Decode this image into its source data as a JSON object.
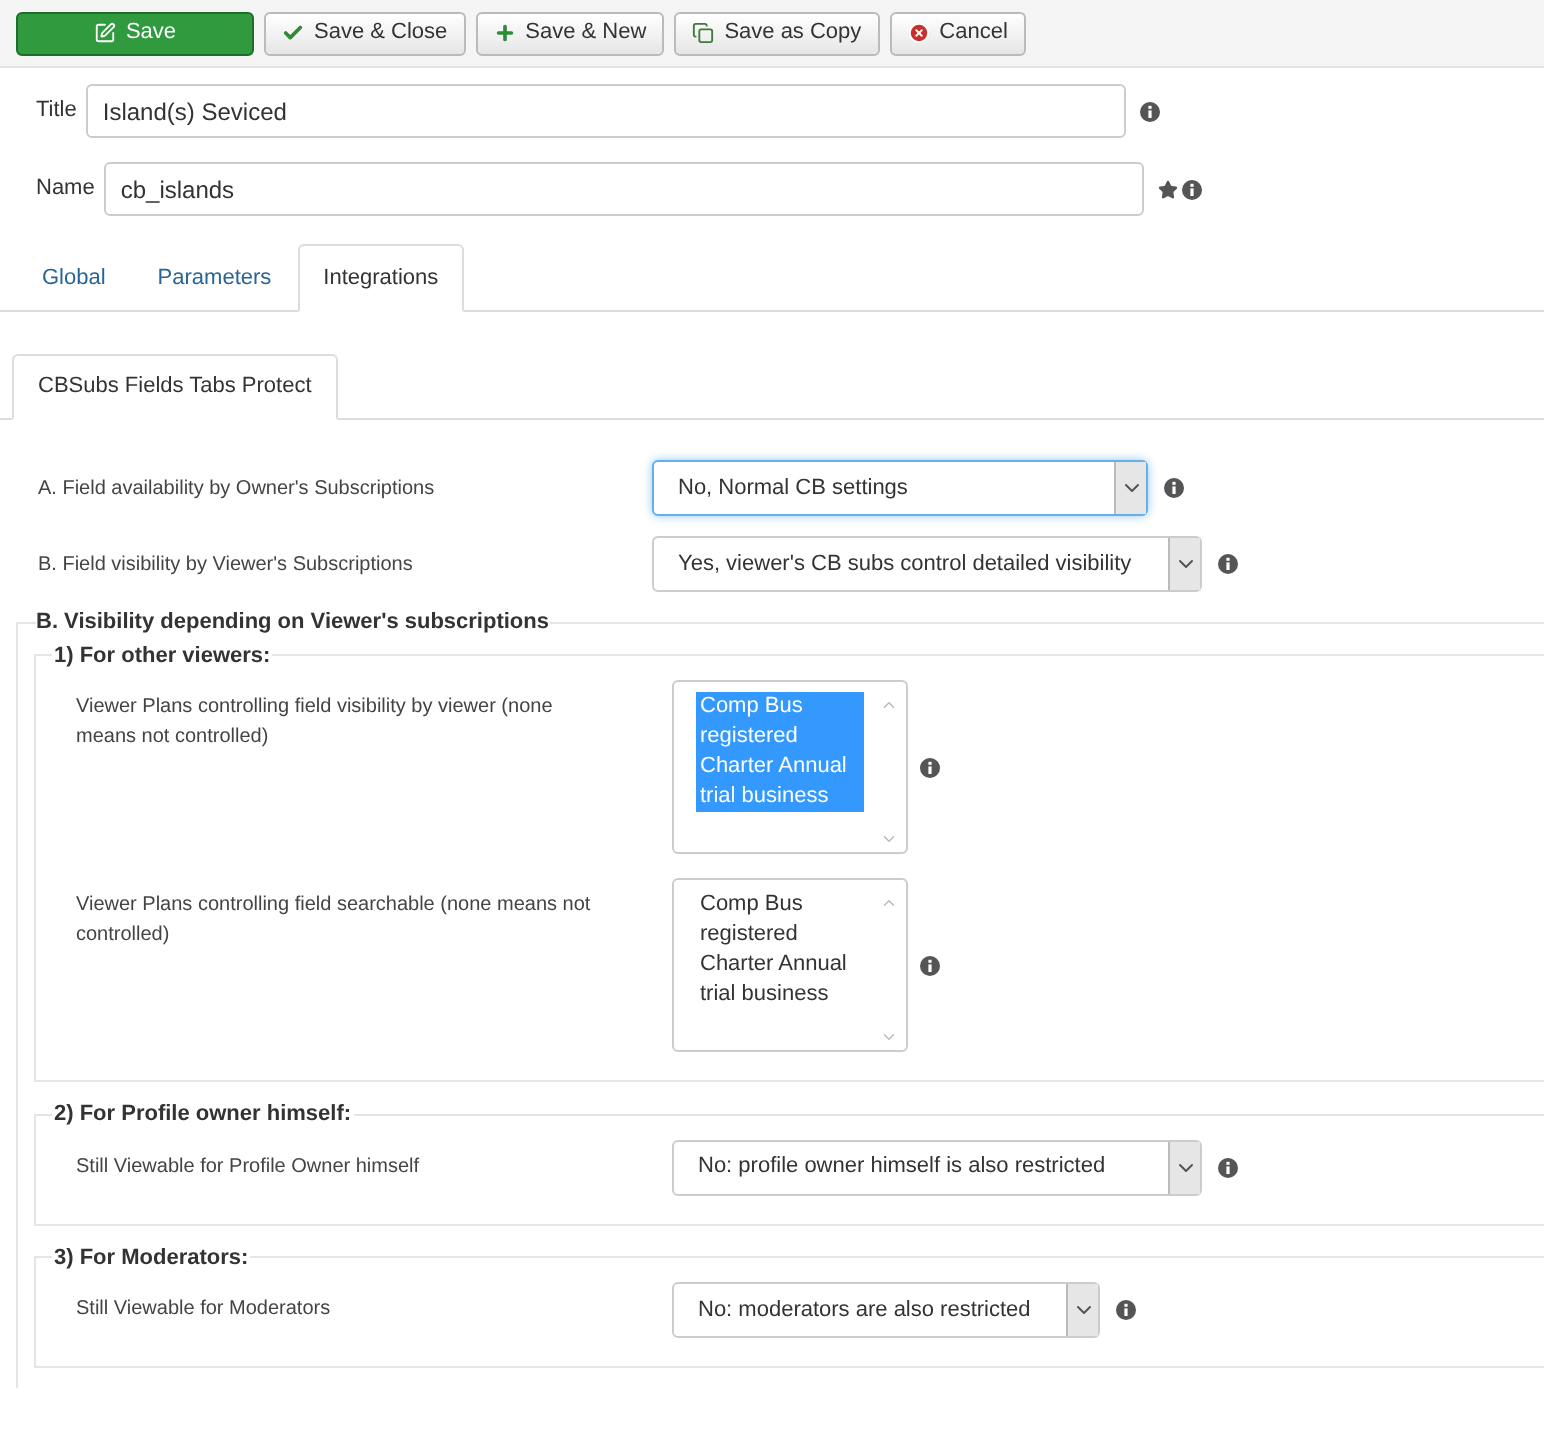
{
  "toolbar": [
    {
      "label": "Save",
      "kind": "primary"
    },
    {
      "label": "Save & Close",
      "kind": "default"
    },
    {
      "label": "Save & New",
      "kind": "default"
    },
    {
      "label": "Save as Copy",
      "kind": "default"
    },
    {
      "label": "Cancel",
      "kind": "default"
    }
  ],
  "header_fields": [
    {
      "label": "Title",
      "value": "Island(s) Seviced",
      "starred": false
    },
    {
      "label": "Name",
      "value": "cb_islands",
      "starred": true
    }
  ],
  "tabs": [
    {
      "label": "Global",
      "selected": false
    },
    {
      "label": "Parameters",
      "selected": false
    },
    {
      "label": "Integrations",
      "selected": true
    }
  ],
  "subtabs": [
    {
      "label": "CBSubs Fields Tabs Protect",
      "selected": true
    }
  ],
  "settings": [
    {
      "label": "A. Field availability by Owner's Subscriptions",
      "value": "No, Normal CB settings",
      "focused": true
    },
    {
      "label": "B. Field visibility by Viewer's Subscriptions",
      "value": "Yes, viewer's CB subs control detailed visibility",
      "focused": false
    }
  ],
  "section": {
    "legend": "B. Visibility depending on Viewer's subscriptions",
    "groups": [
      {
        "legend": "1) For other viewers:",
        "rows": [
          {
            "kind": "listbox",
            "label": "Viewer Plans controlling field visibility by viewer (none means not controlled)",
            "options": [
              {
                "label": "Comp Bus registered",
                "selected": true
              },
              {
                "label": "Charter Annual trial business",
                "selected": true
              }
            ]
          },
          {
            "kind": "listbox",
            "label": "Viewer Plans controlling field searchable (none means not controlled)",
            "options": [
              {
                "label": "Comp Bus registered",
                "selected": false
              },
              {
                "label": "Charter Annual trial business",
                "selected": false
              }
            ]
          }
        ]
      },
      {
        "legend": "2) For Profile owner himself:",
        "rows": [
          {
            "kind": "select",
            "label": "Still Viewable for Profile Owner himself",
            "value": "No: profile owner himself is also restricted"
          }
        ]
      },
      {
        "legend": "3) For Moderators:",
        "rows": [
          {
            "kind": "select",
            "label": "Still Viewable for Moderators",
            "value": "No: moderators are also restricted"
          }
        ]
      }
    ]
  }
}
